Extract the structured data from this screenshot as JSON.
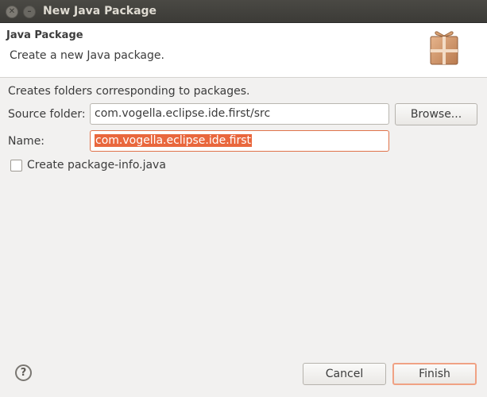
{
  "window": {
    "title": "New Java Package",
    "close_icon": "close-icon",
    "minimize_icon": "minimize-icon"
  },
  "header": {
    "title": "Java Package",
    "description": "Create a new Java package.",
    "icon": "package-icon"
  },
  "body": {
    "description": "Creates folders corresponding to packages.",
    "source_folder": {
      "label": "Source folder:",
      "value": "com.vogella.eclipse.ide.first/src",
      "browse_label": "Browse..."
    },
    "name": {
      "label": "Name:",
      "value": "com.vogella.eclipse.ide.first"
    },
    "package_info": {
      "label": "Create package-info.java",
      "checked": false
    }
  },
  "footer": {
    "help_icon": "help-icon",
    "cancel_label": "Cancel",
    "finish_label": "Finish"
  },
  "colors": {
    "accent": "#e9673d",
    "titlebar": "#3c3b37",
    "background": "#f2f1f0"
  }
}
